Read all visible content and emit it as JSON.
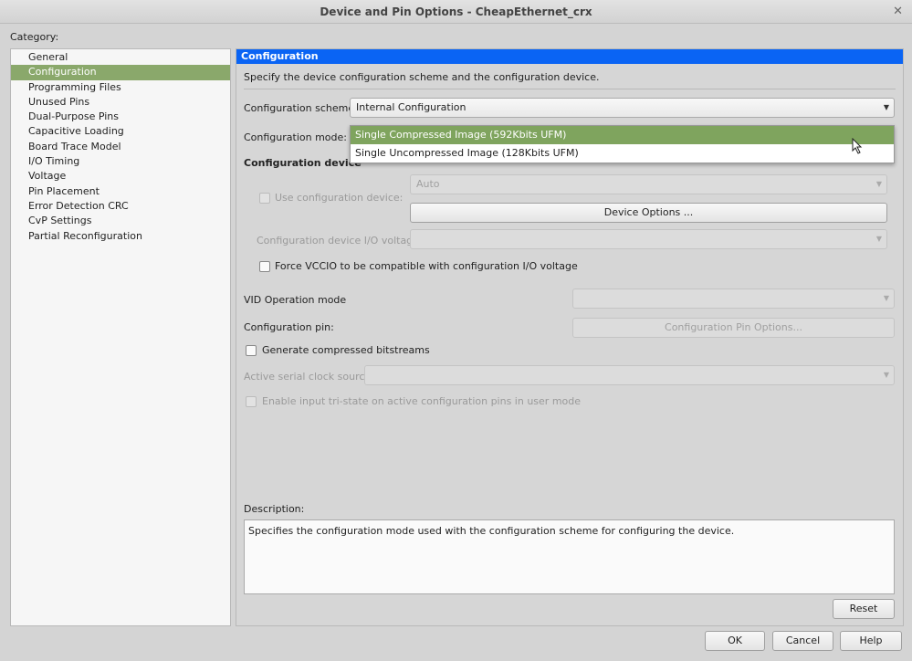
{
  "window": {
    "title": "Device and Pin Options - CheapEthernet_crx",
    "close_icon": "close-icon"
  },
  "category_label": "Category:",
  "categories": [
    "General",
    "Configuration",
    "Programming Files",
    "Unused Pins",
    "Dual-Purpose Pins",
    "Capacitive Loading",
    "Board Trace Model",
    "I/O Timing",
    "Voltage",
    "Pin Placement",
    "Error Detection CRC",
    "CvP Settings",
    "Partial Reconfiguration"
  ],
  "selected_category": "Configuration",
  "panel": {
    "header": "Configuration",
    "intro": "Specify the device configuration scheme and the configuration device.",
    "scheme_label": "Configuration scheme:",
    "scheme_value": "Internal Configuration",
    "mode_label": "Configuration mode:",
    "mode_options": [
      "Single Compressed Image (592Kbits UFM)",
      "Single Uncompressed Image (128Kbits UFM)"
    ],
    "mode_highlighted": "Single Compressed Image (592Kbits UFM)",
    "config_device_heading": "Configuration device",
    "use_config_device_label": "Use configuration device:",
    "use_config_device_checked": false,
    "config_device_value": "Auto",
    "device_options_button": "Device Options ...",
    "io_voltage_label": "Configuration device I/O voltage:",
    "io_voltage_value": "",
    "force_vccio_label": "Force VCCIO to be compatible with configuration I/O voltage",
    "force_vccio_checked": false,
    "vid_label": "VID Operation mode",
    "vid_value": "",
    "config_pin_label": "Configuration pin:",
    "config_pin_button": "Configuration Pin Options...",
    "gen_compressed_label": "Generate compressed bitstreams",
    "gen_compressed_checked": false,
    "clock_source_label": "Active serial clock source:",
    "clock_source_value": "",
    "tristate_label": "Enable input tri-state on active configuration pins in user mode",
    "tristate_checked": false,
    "description_label": "Description:",
    "description_text": "Specifies the configuration mode used with the configuration scheme for configuring the device.",
    "reset_button": "Reset"
  },
  "buttons": {
    "ok": "OK",
    "cancel": "Cancel",
    "help": "Help"
  },
  "colors": {
    "selection": "#8aa86b",
    "header": "#0a64f4"
  }
}
